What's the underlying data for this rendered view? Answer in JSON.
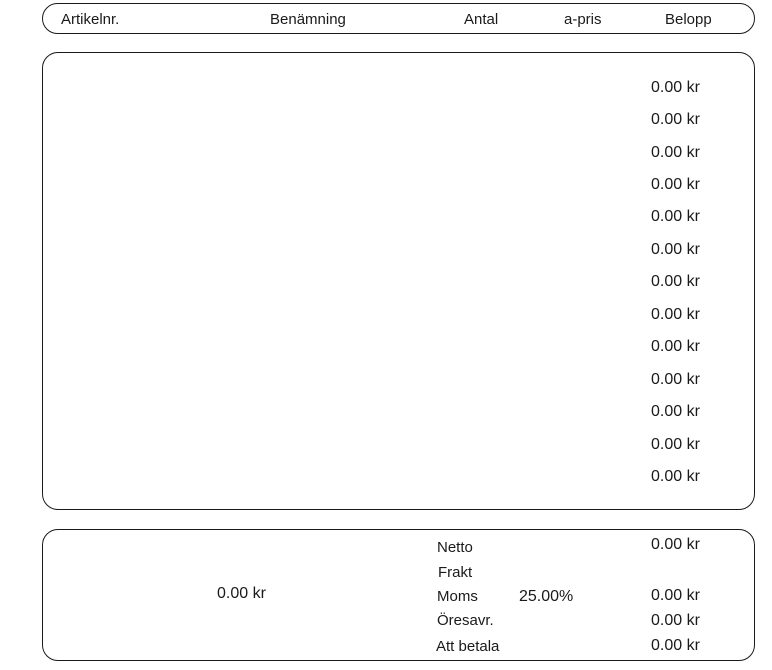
{
  "header": {
    "article_no": "Artikelnr.",
    "description": "Benämning",
    "quantity": "Antal",
    "unit_price": "a-pris",
    "amount": "Belopp"
  },
  "rows": [
    {
      "amount": "0.00 kr"
    },
    {
      "amount": "0.00 kr"
    },
    {
      "amount": "0.00 kr"
    },
    {
      "amount": "0.00 kr"
    },
    {
      "amount": "0.00 kr"
    },
    {
      "amount": "0.00 kr"
    },
    {
      "amount": "0.00 kr"
    },
    {
      "amount": "0.00 kr"
    },
    {
      "amount": "0.00 kr"
    },
    {
      "amount": "0.00 kr"
    },
    {
      "amount": "0.00 kr"
    },
    {
      "amount": "0.00 kr"
    },
    {
      "amount": "0.00 kr"
    }
  ],
  "totals": {
    "left_amount": "0.00 kr",
    "netto_label": "Netto",
    "netto_value": "0.00 kr",
    "frakt_label": "Frakt",
    "moms_label": "Moms",
    "moms_rate": "25.00%",
    "moms_value": "0.00 kr",
    "oresavr_label": "Öresavr.",
    "oresavr_value": "0.00 kr",
    "att_betala_label": "Att betala",
    "att_betala_value": "0.00 kr"
  }
}
